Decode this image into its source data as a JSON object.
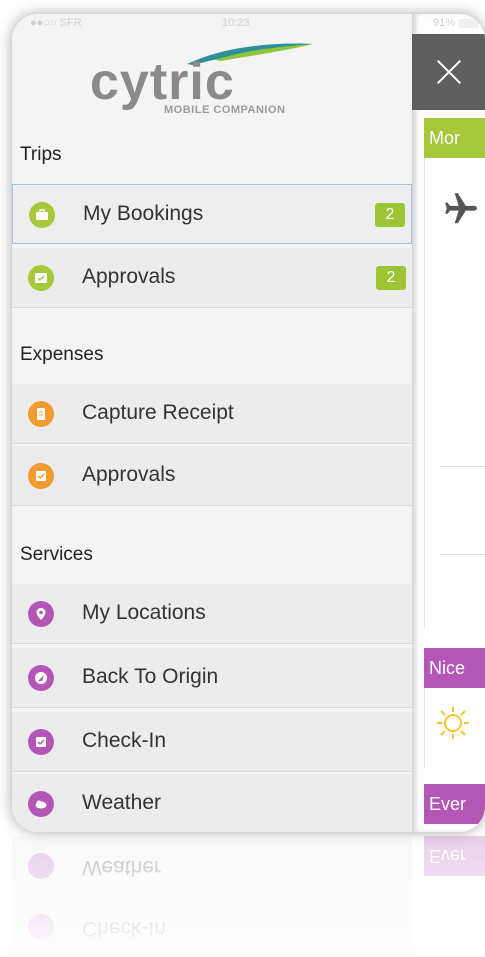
{
  "status_bar": {
    "carrier": "●●○○ SFR",
    "time": "10:23",
    "battery": "91%"
  },
  "logo": {
    "wordmark": "cytric",
    "subtitle": "MOBILE COMPANION"
  },
  "menu": {
    "sections": [
      {
        "title": "Trips",
        "items": [
          {
            "label": "My Bookings",
            "badge": "2",
            "icon": "suitcase-icon",
            "color": "#a6c83a"
          },
          {
            "label": "Approvals",
            "badge": "2",
            "icon": "approval-icon",
            "color": "#a6c83a"
          }
        ]
      },
      {
        "title": "Expenses",
        "items": [
          {
            "label": "Capture Receipt",
            "icon": "receipt-icon",
            "color": "#f39a30"
          },
          {
            "label": "Approvals",
            "icon": "approval-icon",
            "color": "#f39a30"
          }
        ]
      },
      {
        "title": "Services",
        "items": [
          {
            "label": "My Locations",
            "icon": "location-pin-icon",
            "color": "#b356b6"
          },
          {
            "label": "Back To Origin",
            "icon": "navigation-icon",
            "color": "#b356b6"
          },
          {
            "label": "Check-In",
            "icon": "check-in-icon",
            "color": "#b356b6"
          },
          {
            "label": "Weather",
            "icon": "weather-icon",
            "color": "#b356b6"
          }
        ]
      }
    ]
  },
  "panel": {
    "close_icon": "close-icon",
    "cards": [
      {
        "title": "Mor",
        "color": "#a6c83a",
        "icon": "airplane-icon"
      },
      {
        "title": "Nice",
        "color": "#b356b6",
        "icon": "sun-icon"
      },
      {
        "title": "Ever",
        "color": "#b356b6"
      }
    ]
  }
}
